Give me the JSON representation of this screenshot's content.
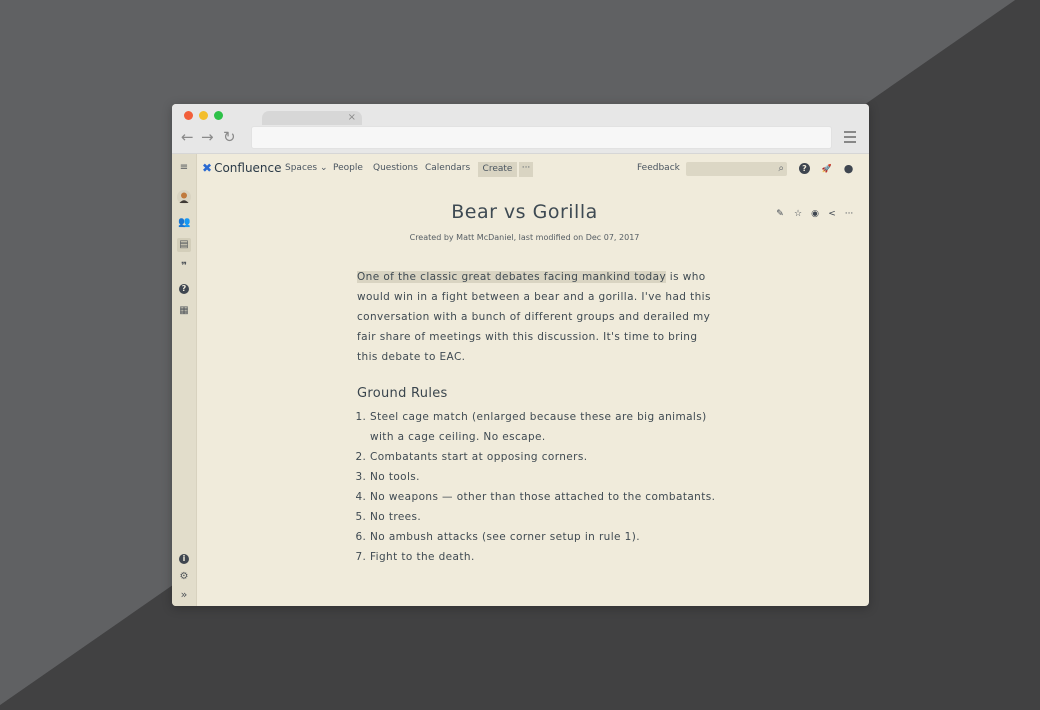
{
  "browser": {
    "tab_close": "×",
    "nav": {
      "back": "←",
      "forward": "→",
      "reload": "↻"
    }
  },
  "sidebar": {
    "items": [
      {
        "name": "menu-icon",
        "glyph": "≡"
      },
      {
        "name": "people-icon",
        "glyph": "👥"
      },
      {
        "name": "pages-icon",
        "glyph": "▤"
      },
      {
        "name": "quote-icon",
        "glyph": "❞"
      },
      {
        "name": "question-icon",
        "glyph": "?"
      },
      {
        "name": "calendar-icon",
        "glyph": "▦"
      },
      {
        "name": "info-icon",
        "glyph": "i"
      },
      {
        "name": "settings-icon",
        "glyph": "⚙"
      },
      {
        "name": "expand-icon",
        "glyph": "»"
      }
    ]
  },
  "header": {
    "logo_text": "Confluence",
    "logo_mark": "✖",
    "nav": {
      "spaces": "Spaces ⌄",
      "people": "People",
      "questions": "Questions",
      "calendars": "Calendars"
    },
    "create": "Create",
    "more": "···",
    "feedback": "Feedback",
    "search_icon": "⌕",
    "help_icon": "?",
    "notifications_icon": "🚀",
    "profile_icon": "●"
  },
  "page": {
    "title": "Bear vs Gorilla",
    "byline": "Created by Matt McDaniel, last modified on Dec 07, 2017",
    "actions": {
      "edit": "✎",
      "star": "☆",
      "watch": "◉",
      "share": "<",
      "more": "···"
    },
    "intro_highlight": "One of the classic great debates facing mankind today",
    "intro_rest": " is who would win in a fight between a bear and a gorilla. I've had this conversation with a bunch of different groups and derailed my fair share of meetings with this discussion. It's time to bring this debate to EAC.",
    "section_title": "Ground Rules",
    "rules": [
      "Steel cage match (enlarged because these are big animals) with a cage ceiling. No escape.",
      "Combatants start at opposing corners.",
      "No tools.",
      "No weapons — other than those attached to the combatants.",
      "No trees.",
      "No ambush attacks (see corner setup in rule 1).",
      "Fight to the death."
    ]
  },
  "colors": {
    "page_bg": "#f0ebdb",
    "sidebar_bg": "#e2ddcb",
    "accent": "#2a6ad1",
    "highlight": "#d9d4c2"
  }
}
